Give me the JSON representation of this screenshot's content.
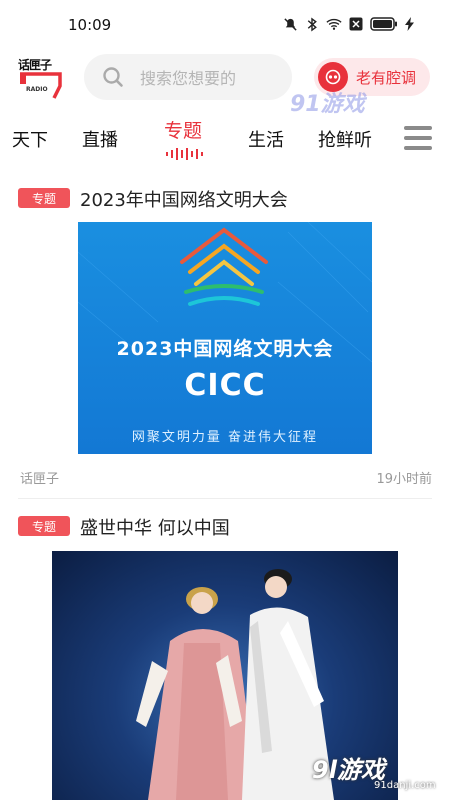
{
  "status_bar": {
    "time": "10:09",
    "icons": [
      "mute-icon",
      "bluetooth-icon",
      "wifi-icon",
      "sim-icon",
      "battery-icon",
      "charging-icon"
    ]
  },
  "header": {
    "logo_text": "话匣子",
    "logo_sub": "RADIO",
    "search_placeholder": "搜索您想要的",
    "tag_label": "老有腔调",
    "accent_color": "#e8323c"
  },
  "watermark": {
    "top_text": "91游戏",
    "bottom_text": "9l游戏",
    "bottom_url": "91danji.com"
  },
  "nav": {
    "tabs": [
      "天下",
      "直播",
      "专题",
      "生活",
      "抢鲜听"
    ],
    "active": "专题"
  },
  "feed": [
    {
      "badge": "专题",
      "title": "2023年中国网络文明大会",
      "banner": {
        "headline": "2023中国网络文明大会",
        "subtitle": "CICC",
        "slogan": "网聚文明力量 奋进伟大征程"
      },
      "source": "话匣子",
      "time": "19小时前"
    },
    {
      "badge": "专题",
      "title": "盛世中华 何以中国"
    }
  ]
}
